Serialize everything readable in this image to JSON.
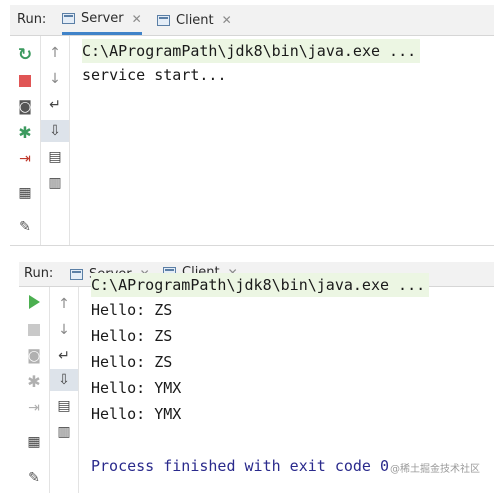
{
  "panels": [
    {
      "run_label": "Run:",
      "tabs": [
        {
          "label": "Server",
          "active": true
        },
        {
          "label": "Client",
          "active": false
        }
      ],
      "console_lines": [
        "C:\\AProgramPath\\jdk8\\bin\\java.exe ...",
        "service start..."
      ]
    },
    {
      "run_label": "Run:",
      "tabs": [
        {
          "label": "Server",
          "active": false
        },
        {
          "label": "Client",
          "active": true
        }
      ],
      "console_partial_line": "C:\\AProgramPath\\jdk8\\bin\\java.exe ...",
      "console_lines": [
        "Hello: ZS",
        "Hello: ZS",
        "Hello: ZS",
        "Hello: YMX",
        "Hello: YMX"
      ],
      "finish_line": "Process finished with exit code 0",
      "watermark": "@稀土掘金技术社区"
    }
  ],
  "icons": {
    "rerun": "↻",
    "stop": "■",
    "camera": "📷",
    "debug": "✱",
    "exit": "⇥",
    "layout": "▦",
    "pin": "📌",
    "up": "↑",
    "down": "↓",
    "wrap": "↵",
    "scroll_end": "⇩",
    "print": "🖶",
    "trash": "🗑"
  },
  "colors": {
    "accent": "#4083c9",
    "rerun": "#3c9a5f",
    "stop": "#e05555",
    "command_bg": "#ecf6e3",
    "finish_text": "#2a2a8c"
  }
}
